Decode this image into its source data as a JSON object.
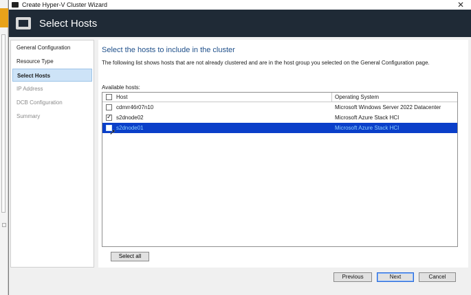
{
  "window": {
    "title": "Create Hyper-V Cluster Wizard",
    "close_glyph": "✕"
  },
  "header": {
    "heading": "Select Hosts",
    "icon": "server-wizard-icon"
  },
  "nav": {
    "items": [
      {
        "label": "General Configuration",
        "state": "normal"
      },
      {
        "label": "Resource Type",
        "state": "normal"
      },
      {
        "label": "Select Hosts",
        "state": "active"
      },
      {
        "label": "IP Address",
        "state": "disabled"
      },
      {
        "label": "DCB Configuration",
        "state": "disabled"
      },
      {
        "label": "Summary",
        "state": "disabled"
      }
    ]
  },
  "main": {
    "title": "Select the hosts to include in the cluster",
    "description": "The following list shows hosts that are not already clustered and are in the host group you selected on the General Configuration page.",
    "list_label": "Available hosts:",
    "columns": {
      "host": "Host",
      "os": "Operating System"
    },
    "rows": [
      {
        "host": "cdmrr46r07n10",
        "os": "Microsoft Windows Server 2022 Datacenter",
        "checked": false,
        "selected": false
      },
      {
        "host": "s2dnode02",
        "os": "Microsoft Azure Stack HCI",
        "checked": true,
        "selected": false
      },
      {
        "host": "s2dnode01",
        "os": "Microsoft Azure Stack HCI",
        "checked": true,
        "selected": true
      }
    ],
    "select_all_label": "Select all"
  },
  "footer": {
    "previous_label": "Previous",
    "next_label": "Next",
    "cancel_label": "Cancel"
  },
  "colors": {
    "header_bg": "#1f2a36",
    "title_blue": "#1e4f8a",
    "selection_bg": "#0a3fc9",
    "nav_active_bg": "#cde3f7"
  }
}
